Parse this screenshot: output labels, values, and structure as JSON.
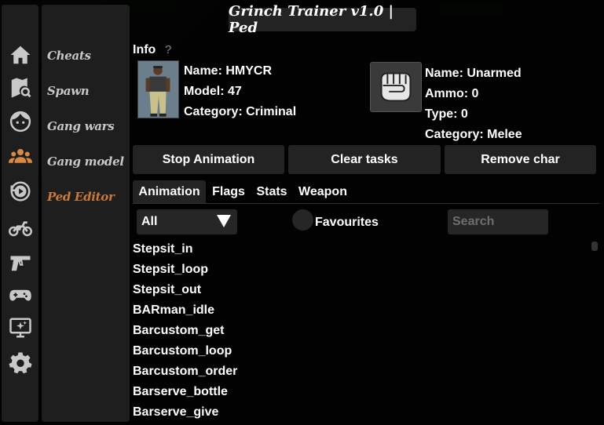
{
  "title": "Grinch Trainer v1.0 | Ped",
  "sidebar_icons": [
    "home-icon",
    "map-search-icon",
    "face-icon",
    "group-icon",
    "replay-icon",
    "motorcycle-icon",
    "pistol-icon",
    "gamepad-icon",
    "monitor-sparkle-icon",
    "gear-icon"
  ],
  "menu": {
    "items": [
      {
        "label": "Cheats"
      },
      {
        "label": "Spawn"
      },
      {
        "label": "Gang wars"
      },
      {
        "label": "Gang model"
      },
      {
        "label": "Ped Editor",
        "active": true
      }
    ]
  },
  "info": {
    "label": "Info",
    "help": "?",
    "ped": {
      "name": "Name: HMYCR",
      "model": "Model: 47",
      "category": "Category: Criminal"
    },
    "weapon": {
      "name": "Name: Unarmed",
      "ammo": "Ammo: 0",
      "type": "Type: 0",
      "category": "Category: Melee"
    }
  },
  "buttons": {
    "stop_animation": "Stop Animation",
    "clear_tasks": "Clear tasks",
    "remove_char": "Remove char"
  },
  "tabs": [
    {
      "label": "Animation",
      "active": true
    },
    {
      "label": "Flags"
    },
    {
      "label": "Stats"
    },
    {
      "label": "Weapon"
    }
  ],
  "filter": {
    "dropdown_value": "All",
    "favourites_label": "Favourites",
    "search_placeholder": "Search"
  },
  "animations": [
    "Stepsit_in",
    "Stepsit_loop",
    "Stepsit_out",
    "BARman_idle",
    "Barcustom_get",
    "Barcustom_loop",
    "Barcustom_order",
    "Barserve_bottle",
    "Barserve_give"
  ],
  "colors": {
    "active_menu": "#c97a3a",
    "active_icon": "#d98a42",
    "panel": "#1e1e1e",
    "button": "#232323"
  }
}
